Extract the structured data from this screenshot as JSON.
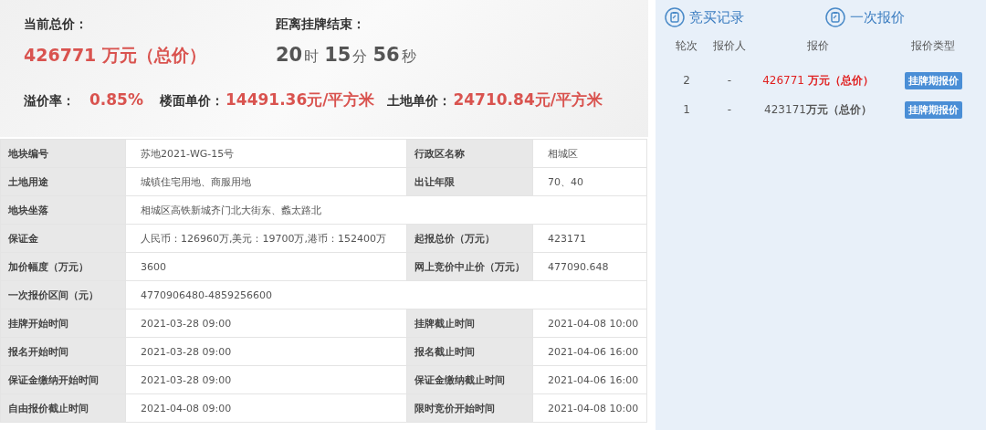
{
  "summary": {
    "current_price": {
      "label": "当前总价：",
      "value": "426771 万元（总价）"
    },
    "countdown": {
      "label": "距离挂牌结束：",
      "parts": [
        {
          "value": "20",
          "unit": "时"
        },
        {
          "value": "15",
          "unit": "分"
        },
        {
          "value": "56",
          "unit": "秒"
        }
      ]
    },
    "stats": [
      {
        "label": "溢价率：",
        "value": "0.85%"
      },
      {
        "label": "楼面单价：",
        "value": "14491.36元/平方米"
      },
      {
        "label": "土地单价：",
        "value": "24710.84元/平方米"
      }
    ]
  },
  "info_table": {
    "rows": [
      [
        {
          "label": "地块编号",
          "value": "苏地2021-WG-15号"
        },
        {
          "label": "行政区名称",
          "value": "相城区"
        }
      ],
      [
        {
          "label": "土地用途",
          "value": "城镇住宅用地、商服用地"
        },
        {
          "label": "出让年限",
          "value": "70、40"
        }
      ],
      [
        {
          "label": "地块坐落",
          "value": "相城区高铁新城齐门北大街东、蠡太路北"
        }
      ],
      [
        {
          "label": "保证金",
          "value": "人民币：126960万,美元：19700万,港币：152400万"
        },
        {
          "label": "起报总价（万元）",
          "value": "423171"
        }
      ],
      [
        {
          "label": "加价幅度（万元）",
          "value": "3600"
        },
        {
          "label": "网上竞价中止价（万元）",
          "value": "477090.648"
        }
      ],
      [
        {
          "label": "一次报价区间（元）",
          "value": "4770906480-4859256600"
        }
      ],
      [
        {
          "label": "挂牌开始时间",
          "value": "2021-03-28 09:00"
        },
        {
          "label": "挂牌截止时间",
          "value": "2021-04-08 10:00"
        }
      ],
      [
        {
          "label": "报名开始时间",
          "value": "2021-03-28 09:00"
        },
        {
          "label": "报名截止时间",
          "value": "2021-04-06 16:00"
        }
      ],
      [
        {
          "label": "保证金缴纳开始时间",
          "value": "2021-03-28 09:00"
        },
        {
          "label": "保证金缴纳截止时间",
          "value": "2021-04-06 16:00"
        }
      ],
      [
        {
          "label": "自由报价截止时间",
          "value": "2021-04-08 09:00"
        },
        {
          "label": "限时竞价开始时间",
          "value": "2021-04-08 10:00"
        }
      ]
    ]
  },
  "bid_panel": {
    "tabs": [
      {
        "label": "竞买记录"
      },
      {
        "label": "一次报价"
      }
    ],
    "columns": [
      "轮次",
      "报价人",
      "报价",
      "报价类型"
    ],
    "rows": [
      {
        "round": "2",
        "bidder": "-",
        "price": "426771 **万元（总价）**",
        "type": "挂牌期报价",
        "highlighted": true
      },
      {
        "round": "1",
        "bidder": "-",
        "price": "423171**万元（总价）**",
        "type": "挂牌期报价",
        "highlighted": false
      }
    ]
  }
}
